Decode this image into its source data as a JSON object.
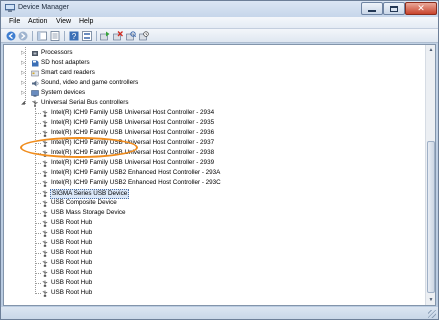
{
  "window": {
    "title": "Device Manager",
    "accent": "#c4d3e6"
  },
  "menu": [
    {
      "label": "File"
    },
    {
      "label": "Action"
    },
    {
      "label": "View"
    },
    {
      "label": "Help"
    }
  ],
  "toolbar": {
    "icons": [
      "back-icon",
      "forward-icon",
      "console-tree-icon",
      "properties-icon",
      "help-icon",
      "view-icon",
      "update-driver-icon",
      "uninstall-icon",
      "scan-hardware-icon",
      "disable-icon"
    ]
  },
  "tree": {
    "categories": [
      {
        "label": "Processors"
      },
      {
        "label": "SD host adapters"
      },
      {
        "label": "Smart card readers"
      },
      {
        "label": "Sound, video and game controllers"
      },
      {
        "label": "System devices"
      },
      {
        "label": "Universal Serial Bus controllers"
      }
    ],
    "usb_children": [
      {
        "label": "Intel(R) ICH9 Family USB Universal Host Controller - 2934"
      },
      {
        "label": "Intel(R) ICH9 Family USB Universal Host Controller - 2935"
      },
      {
        "label": "Intel(R) ICH9 Family USB Universal Host Controller - 2936"
      },
      {
        "label": "Intel(R) ICH9 Family USB Universal Host Controller - 2937"
      },
      {
        "label": "Intel(R) ICH9 Family USB Universal Host Controller - 2938"
      },
      {
        "label": "Intel(R) ICH9 Family USB Universal Host Controller - 2939"
      },
      {
        "label": "Intel(R) ICH9 Family USB2 Enhanced Host Controller - 293A"
      },
      {
        "label": "Intel(R) ICH9 Family USB2 Enhanced Host Controller - 293C"
      },
      {
        "label": "SIGMA Series USB Device",
        "selected": true
      },
      {
        "label": "USB Composite Device"
      },
      {
        "label": "USB Mass Storage Device"
      },
      {
        "label": "USB Root Hub"
      },
      {
        "label": "USB Root Hub"
      },
      {
        "label": "USB Root Hub"
      },
      {
        "label": "USB Root Hub"
      },
      {
        "label": "USB Root Hub"
      },
      {
        "label": "USB Root Hub"
      },
      {
        "label": "USB Root Hub"
      },
      {
        "label": "USB Root Hub"
      }
    ]
  },
  "highlight_color": "#f08c1c"
}
